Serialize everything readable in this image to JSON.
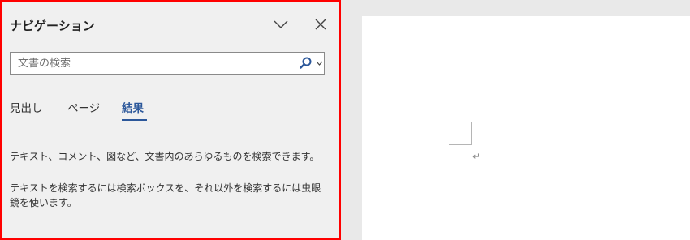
{
  "navigation_pane": {
    "title": "ナビゲーション",
    "options_icon": "chevron-down-icon",
    "close_icon": "close-icon",
    "search": {
      "value": "",
      "placeholder": "文書の検索",
      "icon": "search-icon"
    },
    "tabs": [
      {
        "label": "見出し",
        "selected": false
      },
      {
        "label": "ページ",
        "selected": false
      },
      {
        "label": "結果",
        "selected": true
      }
    ],
    "messages": [
      "テキスト、コメント、図など、文書内のあらゆるものを検索できます。",
      "テキストを検索するには検索ボックスを、それ以外を検索するには虫眼鏡を使います。"
    ]
  },
  "document": {
    "paragraph_mark": "↵"
  },
  "colors": {
    "highlight_border": "#ff0000",
    "accent": "#2b579a",
    "pane_background": "#f0f0f0"
  }
}
